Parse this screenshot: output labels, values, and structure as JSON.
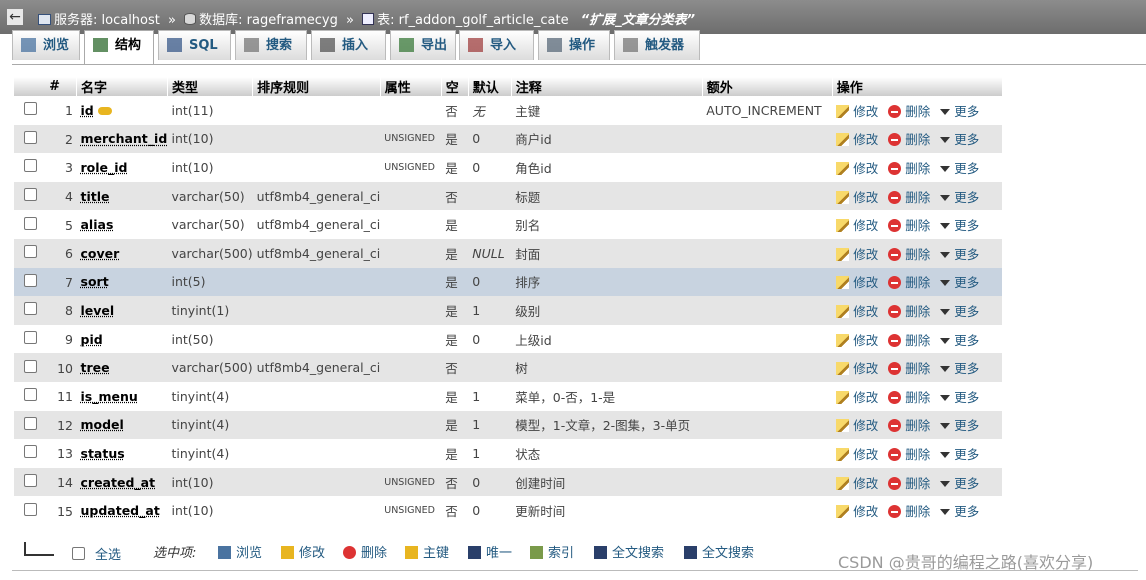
{
  "breadcrumb": {
    "server_label": "服务器: localhost",
    "db_label": "数据库: rageframecyg",
    "table_label": "表: rf_addon_golf_article_cate",
    "table_comment": "“扩展_文章分类表”",
    "sep": "»"
  },
  "tabs": [
    {
      "label": "浏览",
      "icon": "browse-icon"
    },
    {
      "label": "结构",
      "icon": "structure-icon",
      "active": true
    },
    {
      "label": "SQL",
      "icon": "sql-icon"
    },
    {
      "label": "搜索",
      "icon": "search-icon"
    },
    {
      "label": "插入",
      "icon": "insert-icon"
    },
    {
      "label": "导出",
      "icon": "export-icon"
    },
    {
      "label": "导入",
      "icon": "import-icon"
    },
    {
      "label": "操作",
      "icon": "wrench-icon"
    },
    {
      "label": "触发器",
      "icon": "trigger-icon"
    }
  ],
  "columns": [
    "#",
    "名字",
    "类型",
    "排序规则",
    "属性",
    "空",
    "默认",
    "注释",
    "额外",
    "操作"
  ],
  "actions": {
    "edit": "修改",
    "delete": "删除",
    "more": "更多"
  },
  "rows": [
    {
      "num": "1",
      "name": "id",
      "type": "int(11)",
      "collation": "",
      "attr": "",
      "null": "否",
      "default": "无",
      "comment": "主键",
      "extra": "AUTO_INCREMENT",
      "primary": true
    },
    {
      "num": "2",
      "name": "merchant_id",
      "type": "int(10)",
      "collation": "",
      "attr": "UNSIGNED",
      "null": "是",
      "default": "0",
      "comment": "商户id",
      "extra": ""
    },
    {
      "num": "3",
      "name": "role_id",
      "type": "int(10)",
      "collation": "",
      "attr": "UNSIGNED",
      "null": "是",
      "default": "0",
      "comment": "角色id",
      "extra": ""
    },
    {
      "num": "4",
      "name": "title",
      "type": "varchar(50)",
      "collation": "utf8mb4_general_ci",
      "attr": "",
      "null": "否",
      "default": "",
      "comment": "标题",
      "extra": ""
    },
    {
      "num": "5",
      "name": "alias",
      "type": "varchar(50)",
      "collation": "utf8mb4_general_ci",
      "attr": "",
      "null": "是",
      "default": "",
      "comment": "别名",
      "extra": ""
    },
    {
      "num": "6",
      "name": "cover",
      "type": "varchar(500)",
      "collation": "utf8mb4_general_ci",
      "attr": "",
      "null": "是",
      "default": "NULL",
      "comment": "封面",
      "extra": ""
    },
    {
      "num": "7",
      "name": "sort",
      "type": "int(5)",
      "collation": "",
      "attr": "",
      "null": "是",
      "default": "0",
      "comment": "排序",
      "extra": "",
      "highlight": true
    },
    {
      "num": "8",
      "name": "level",
      "type": "tinyint(1)",
      "collation": "",
      "attr": "",
      "null": "是",
      "default": "1",
      "comment": "级别",
      "extra": ""
    },
    {
      "num": "9",
      "name": "pid",
      "type": "int(50)",
      "collation": "",
      "attr": "",
      "null": "是",
      "default": "0",
      "comment": "上级id",
      "extra": ""
    },
    {
      "num": "10",
      "name": "tree",
      "type": "varchar(500)",
      "collation": "utf8mb4_general_ci",
      "attr": "",
      "null": "否",
      "default": "",
      "comment": "树",
      "extra": ""
    },
    {
      "num": "11",
      "name": "is_menu",
      "type": "tinyint(4)",
      "collation": "",
      "attr": "",
      "null": "是",
      "default": "1",
      "comment": "菜单，0-否，1-是",
      "extra": ""
    },
    {
      "num": "12",
      "name": "model",
      "type": "tinyint(4)",
      "collation": "",
      "attr": "",
      "null": "是",
      "default": "1",
      "comment": "模型，1-文章，2-图集，3-单页",
      "extra": ""
    },
    {
      "num": "13",
      "name": "status",
      "type": "tinyint(4)",
      "collation": "",
      "attr": "",
      "null": "是",
      "default": "1",
      "comment": "状态",
      "extra": ""
    },
    {
      "num": "14",
      "name": "created_at",
      "type": "int(10)",
      "collation": "",
      "attr": "UNSIGNED",
      "null": "否",
      "default": "0",
      "comment": "创建时间",
      "extra": ""
    },
    {
      "num": "15",
      "name": "updated_at",
      "type": "int(10)",
      "collation": "",
      "attr": "UNSIGNED",
      "null": "否",
      "default": "0",
      "comment": "更新时间",
      "extra": ""
    }
  ],
  "bottom": {
    "select_all": "全选",
    "with_selected": "选中项:",
    "actions": [
      {
        "label": "浏览",
        "icon": "browse-icon"
      },
      {
        "label": "修改",
        "icon": "pencil-icon"
      },
      {
        "label": "删除",
        "icon": "delete-icon"
      },
      {
        "label": "主键",
        "icon": "key-icon"
      },
      {
        "label": "唯一",
        "icon": "unique-icon"
      },
      {
        "label": "索引",
        "icon": "index-icon"
      },
      {
        "label": "全文搜索",
        "icon": "fulltext-icon"
      },
      {
        "label": "全文搜索",
        "icon": "fulltext-icon"
      }
    ]
  },
  "watermark": "CSDN @贵哥的编程之路(喜欢分享)"
}
